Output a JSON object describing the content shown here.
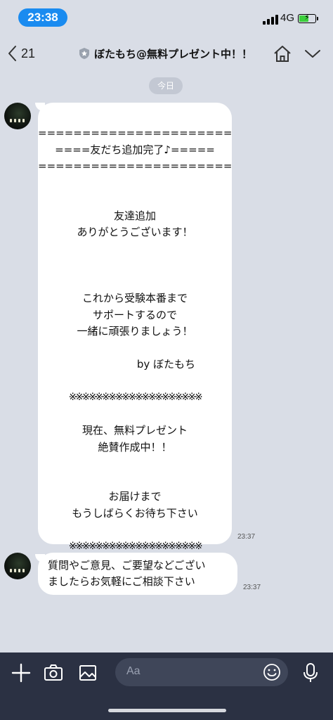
{
  "status": {
    "time": "23:38",
    "network": "4G"
  },
  "header": {
    "back_count": "21",
    "title": "ぼたもち@無料プレゼント中！！"
  },
  "date_chip": "今日",
  "messages": [
    {
      "lines": [
        "======================",
        "====友だち追加完了♪=====",
        "======================",
        "",
        "",
        "友達追加",
        "ありがとうございます！",
        "",
        "",
        "",
        "これから受験本番まで",
        "サポートするので",
        "一緒に頑張りましょう！",
        "",
        "by ぼたもち",
        "",
        "※※※※※※※※※※※※※※※※※※※※",
        "",
        "現在、無料プレゼント",
        "絶賛作成中！！",
        "",
        "",
        "お届けまで",
        "もうしばらくお待ち下さい",
        "",
        "※※※※※※※※※※※※※※※※※※※※"
      ],
      "time": "23:37"
    },
    {
      "lines": [
        "質問やご意見、ご要望などござい",
        "ましたらお気軽にご相談下さい"
      ],
      "time": "23:37"
    }
  ],
  "input": {
    "placeholder": "Aa"
  },
  "icons": {
    "back": "chevron-left-icon",
    "shield": "shield-icon",
    "home": "home-icon",
    "menu": "chevron-down-icon",
    "plus": "plus-icon",
    "camera": "camera-icon",
    "image": "image-icon",
    "emoji": "emoji-icon",
    "mic": "mic-icon"
  },
  "colors": {
    "time_pill": "#1a8bf0",
    "background": "#d9dde6",
    "bottom_bar": "#2b3143"
  }
}
